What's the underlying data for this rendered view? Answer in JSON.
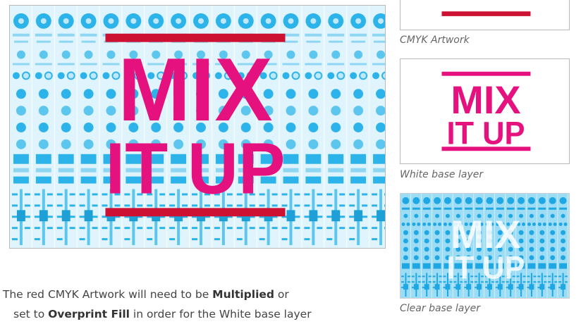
{
  "colors": {
    "magenta": "#e5117e",
    "red": "#cc1133",
    "cyan": "#2bb3ea",
    "cyan_light": "#bfe8f8",
    "white": "#ffffff",
    "border": "#b9b9b9"
  },
  "artwork": {
    "line1": "MIX",
    "line2": "IT UP"
  },
  "thumbnails": [
    {
      "caption": "CMYK Artwork"
    },
    {
      "caption": "White base layer",
      "line1": "MIX",
      "line2": "IT UP"
    },
    {
      "caption": "Clear base layer",
      "line1": "MIX",
      "line2": "IT UP"
    }
  ],
  "body": {
    "line1_pre": ". The red CMYK Artwork will need to be ",
    "line1_bold": "Multiplied",
    "line1_post": " or",
    "line2_pre": "set to ",
    "line2_bold": "Overprint Fill",
    "line2_post": " in order for the White base layer"
  }
}
